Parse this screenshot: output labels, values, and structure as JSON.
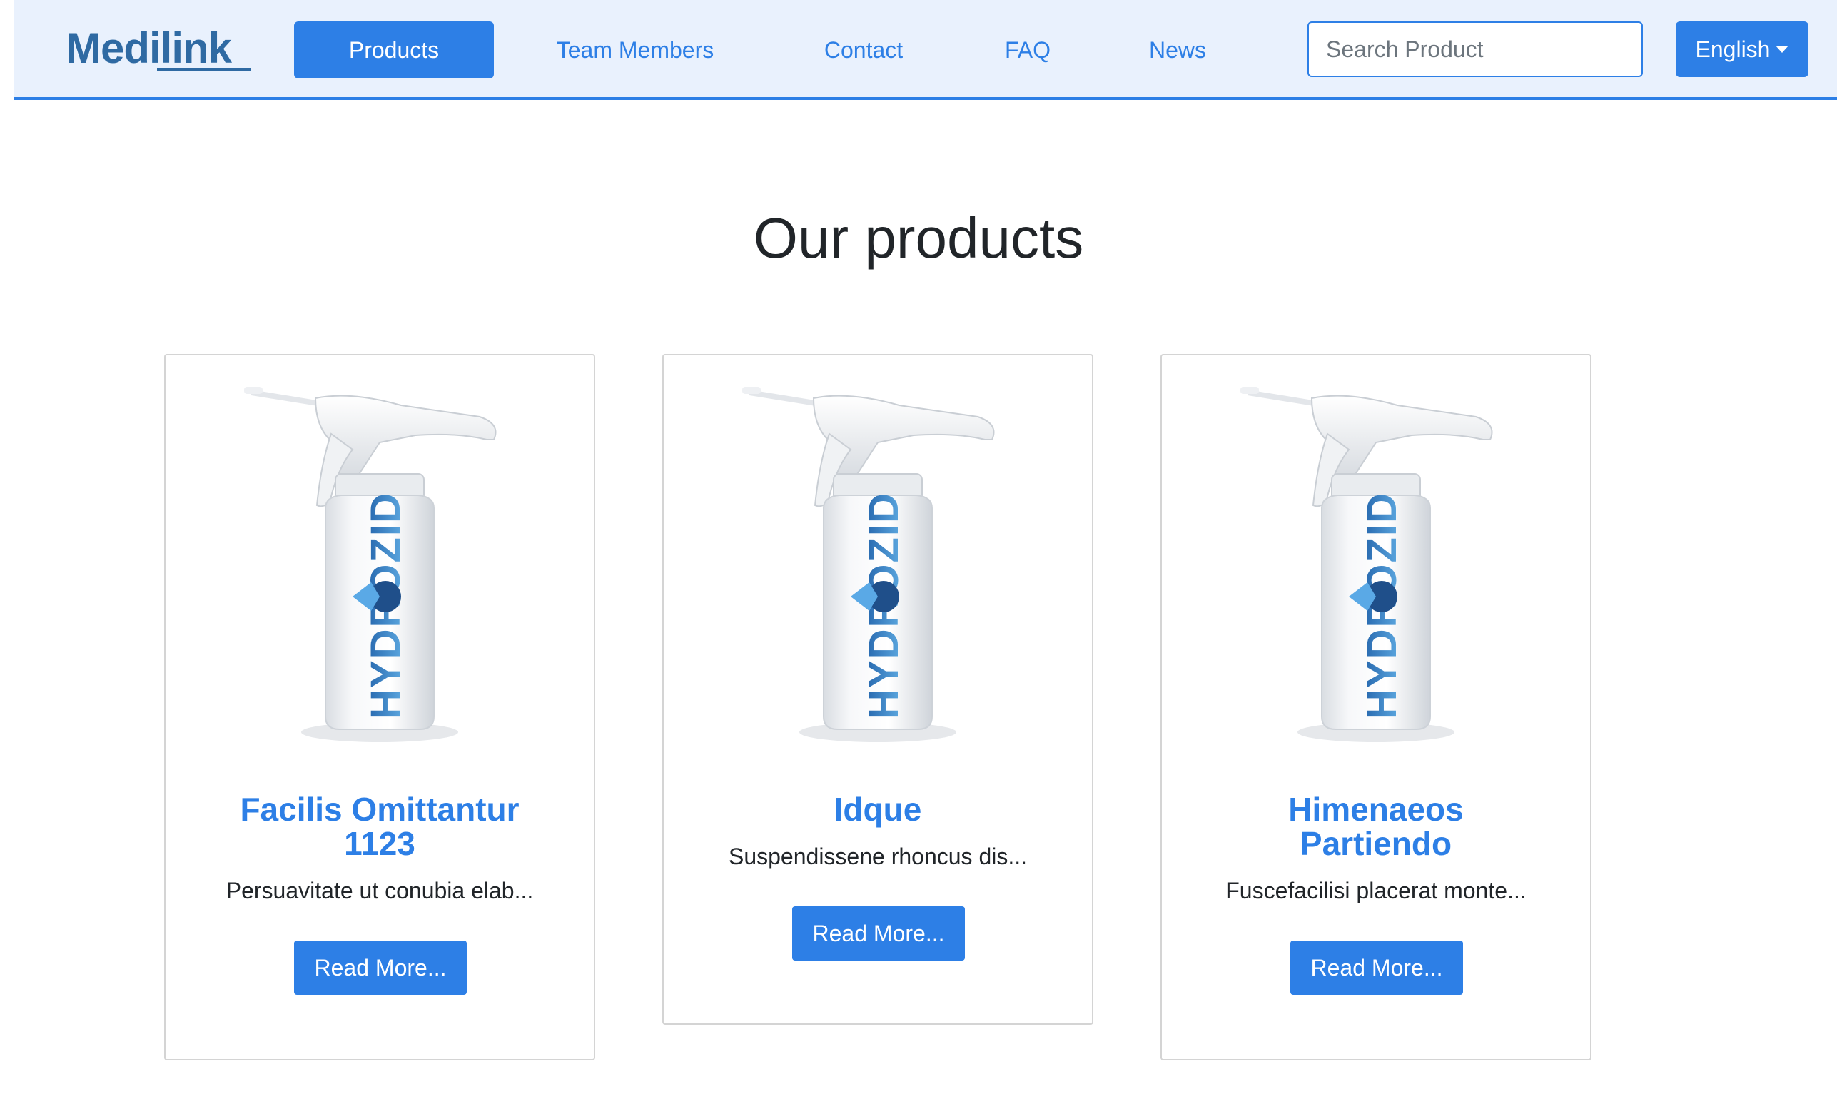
{
  "brand": {
    "logo_text": "Medilink"
  },
  "nav": {
    "items": [
      {
        "label": "Products",
        "active": true
      },
      {
        "label": "Team Members",
        "active": false
      },
      {
        "label": "Contact",
        "active": false
      },
      {
        "label": "FAQ",
        "active": false
      },
      {
        "label": "News",
        "active": false
      }
    ],
    "search_placeholder": "Search Product",
    "language": "English"
  },
  "main": {
    "title": "Our products",
    "products": [
      {
        "title_line1": "Facilis Omittantur",
        "title_line2": "1123",
        "description": "Persuavitate ut conubia elab...",
        "button": "Read More...",
        "image_label": "HYDROZID"
      },
      {
        "title_line1": "Idque",
        "title_line2": "",
        "description": "Suspendissene rhoncus dis...",
        "button": "Read More...",
        "image_label": "HYDROZID"
      },
      {
        "title_line1": "Himenaeos",
        "title_line2": "Partiendo",
        "description": "Fuscefacilisi placerat monte...",
        "button": "Read More...",
        "image_label": "HYDROZID"
      }
    ]
  },
  "colors": {
    "accent": "#2d7fe6",
    "navbar_bg": "#e9f1fd",
    "logo": "#2f6aa3"
  }
}
